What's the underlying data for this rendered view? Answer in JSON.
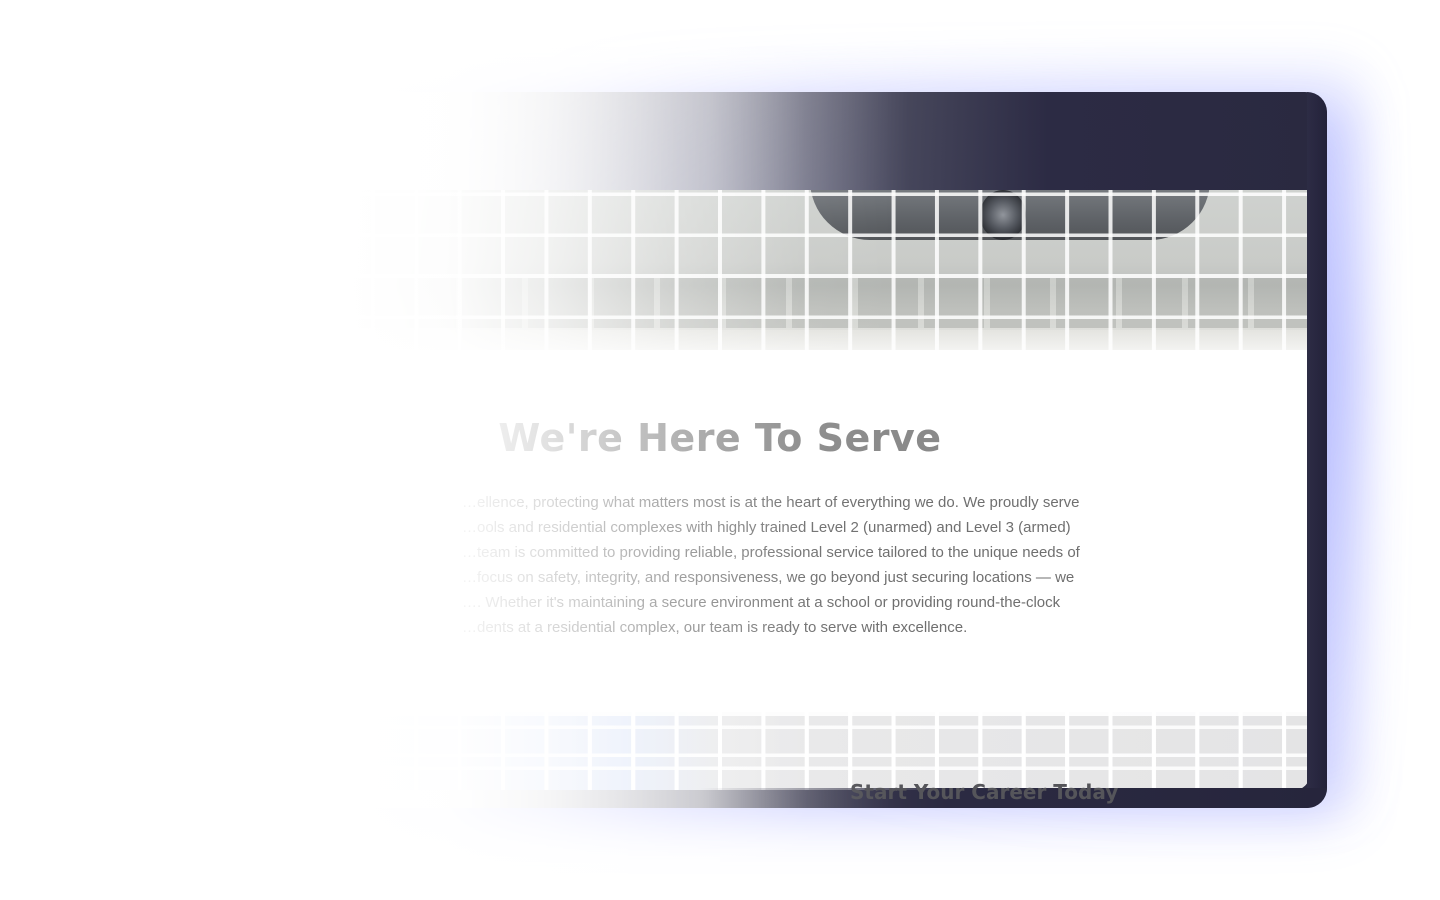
{
  "section": {
    "title": "We're Here To Serve",
    "body_lines": [
      "…ellence, protecting what matters most is at the heart of everything we do. We proudly serve",
      "…ools and residential complexes with highly trained Level 2 (unarmed) and Level 3 (armed)",
      "…team is committed to providing reliable, professional service tailored to the unique needs of",
      "…focus on safety, integrity, and responsiveness, we go beyond just securing locations — we",
      "…. Whether it's maintaining a secure environment at a school or providing round-the-clock",
      "…dents at a residential complex, our team is ready to serve with excellence."
    ]
  },
  "cta": {
    "title": "Start Your Career Today"
  },
  "colors": {
    "device_frame": "#2c2b44",
    "glow": "#8c96ff",
    "title_text": "#8a8a8a",
    "body_text": "#6f6f6f"
  }
}
